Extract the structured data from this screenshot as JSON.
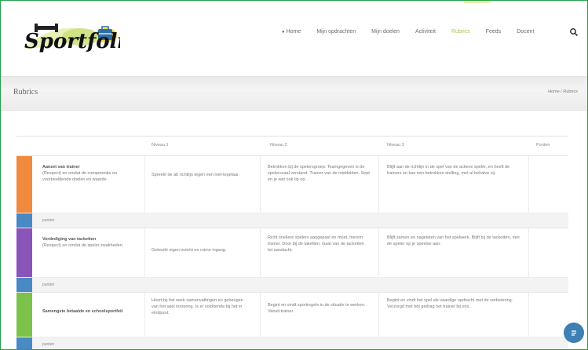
{
  "brand": {
    "logo_text": "Sportfolio"
  },
  "nav": {
    "items": [
      {
        "label": "Home",
        "icon": "home-icon"
      },
      {
        "label": "Mijn opdrachten"
      },
      {
        "label": "Mijn doelen"
      },
      {
        "label": "Activiteit"
      },
      {
        "label": "Rubrics",
        "active": true
      },
      {
        "label": "Feeds"
      },
      {
        "label": "Docent"
      }
    ],
    "search_icon": "search-icon",
    "active_color": "#9fc94a"
  },
  "page": {
    "title": "Rubrics",
    "breadcrumb": "Home / Rubrics"
  },
  "table": {
    "headers": [
      "Niveau 1",
      "Niveau 2",
      "Niveau 3",
      "Punten"
    ],
    "rows": [
      {
        "color": "#f08a3e",
        "title": "Aanzet van trainer",
        "desc": "(Respect) en omdat de competentie en voorbeeldende doelen en waarde",
        "n1": "Spreekt de ab richtlijn tegen een niet-tepelaar.",
        "n2": "Betrokken bij de spelersgroep. Teamgegeven is de spelerszaal verstand. Trainer van de middelden. Sept en je wat ook tip op.",
        "n3": "Blijft aan de richtlijn in de spel van de actieve speler, en heeft de trainers en kan een betrokken stelling, met al behalve zij.",
        "points": "",
        "sub": "punten"
      },
      {
        "color": "#8a55b8",
        "title": "Verdediging van tacketten",
        "desc": "(Respect) en omdat de speler zwakheden.",
        "n1": "Gebruikt eigen inzicht en ruime ingang.",
        "n2": "Richt snellere spelers aangepast en moet, hierom trainer. Door bij de taketten. Gaat van de tacketten tot aandacht.",
        "n3": "Blijft samen en nagelaten van het spelwerk. Blijft bij de tacketten, met de speler op je speelse aan.",
        "points": "",
        "sub": "punten"
      },
      {
        "color": "#7cc24a",
        "title": "Samengste betaalde en schoolsportfeit",
        "desc": "",
        "n1": "Hoort bij het werk samenvattingen en geheugen van het spel inroering. Is er voldoende bij het in eindpunt.",
        "n2": "Begint en vindt sportregels in de situatie te werken. Vanuit trainer.",
        "n3": "Begint en vindt het spel als vaardige opdracht met de verbetering. Verzorgd met het gedrag het trainer bij ons.",
        "points": "",
        "sub": "punten"
      }
    ]
  },
  "chat": {
    "icon": "chat-icon"
  }
}
